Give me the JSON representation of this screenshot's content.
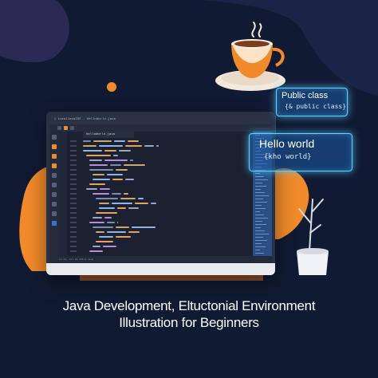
{
  "editor": {
    "window_title": "▯ LocalJavaIDE - HelloWorld.java",
    "tab_label": "HelloWorld.java",
    "status_text": "Ln 14, Col 22   UTF-8   Java"
  },
  "panels": {
    "public_class": {
      "title": "Public class",
      "subtitle": "{& public class}"
    },
    "hello_world": {
      "title": "Hello world",
      "subtitle": "{kho world}"
    }
  },
  "caption": {
    "line1": "Java Development, Eltuctonial Environment",
    "line2": "Illustration for Beginners"
  },
  "colors": {
    "background": "#111a33",
    "accent_orange": "#f08a2a",
    "glow_blue": "#5fd6ff"
  },
  "icons": [
    "coffee-cup-icon",
    "plant-pot-icon",
    "java-logo-icon"
  ]
}
